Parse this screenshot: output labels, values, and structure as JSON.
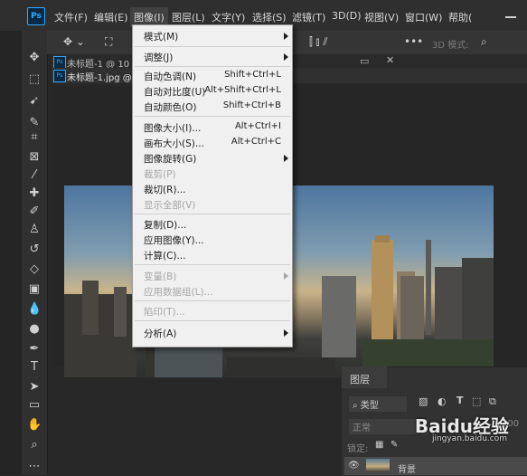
{
  "menubar": {
    "items": [
      "文件(F)",
      "编辑(E)",
      "图像(I)",
      "图层(L)",
      "文字(Y)",
      "选择(S)",
      "滤镜(T)",
      "3D(D)",
      "视图(V)",
      "窗口(W)",
      "帮助("
    ]
  },
  "app_logo": "Ps",
  "optionsbar": {
    "mode_3d": "3D 模式:"
  },
  "doc_tabs": [
    {
      "title": "未标题-1 @ 10"
    },
    {
      "title": "未标题-1.jpg @"
    }
  ],
  "image_menu": {
    "items": [
      {
        "label": "模式(M)",
        "submenu": true
      },
      {
        "label": "调整(J)",
        "submenu": true
      },
      {
        "label": "自动色调(N)",
        "shortcut": "Shift+Ctrl+L"
      },
      {
        "label": "自动对比度(U)",
        "shortcut": "Alt+Shift+Ctrl+L"
      },
      {
        "label": "自动颜色(O)",
        "shortcut": "Shift+Ctrl+B"
      },
      {
        "label": "图像大小(I)...",
        "shortcut": "Alt+Ctrl+I"
      },
      {
        "label": "画布大小(S)...",
        "shortcut": "Alt+Ctrl+C"
      },
      {
        "label": "图像旋转(G)",
        "submenu": true
      },
      {
        "label": "裁剪(P)",
        "disabled": true
      },
      {
        "label": "裁切(R)..."
      },
      {
        "label": "显示全部(V)",
        "disabled": true
      },
      {
        "label": "复制(D)..."
      },
      {
        "label": "应用图像(Y)..."
      },
      {
        "label": "计算(C)..."
      },
      {
        "label": "变量(B)",
        "disabled": true,
        "submenu": true
      },
      {
        "label": "应用数据组(L)...",
        "disabled": true
      },
      {
        "label": "陷印(T)...",
        "disabled": true
      },
      {
        "label": "分析(A)",
        "submenu": true
      }
    ]
  },
  "layers_panel": {
    "tab": "图层",
    "filter_label": "类型",
    "blend_mode": "正常",
    "lock_label": "锁定:",
    "opacity_short": "100",
    "layer_name": "背景"
  },
  "watermark": {
    "brand": "Baidu经验",
    "url": "jingyan.baidu.com"
  },
  "colors": {
    "accent": "#31a8ff",
    "menu_bg": "#f0f0f0",
    "app_bg": "#282828"
  }
}
